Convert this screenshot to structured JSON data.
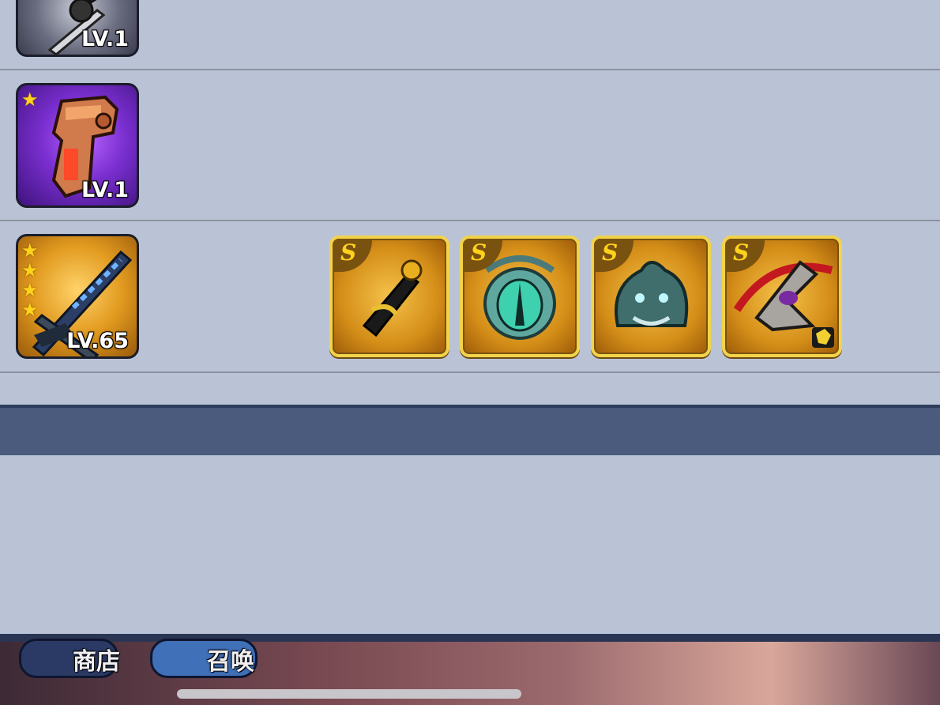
{
  "weapons": [
    {
      "level": "LV.1",
      "stars": 0,
      "icon": "katana-icon"
    },
    {
      "level": "LV.1",
      "stars": 1,
      "icon": "pipe-wrench-icon"
    },
    {
      "level": "LV.65",
      "stars": 4,
      "icon": "crossed-swords-icon"
    }
  ],
  "skills": [
    {
      "grade": "S",
      "icon": "scroll-icon"
    },
    {
      "grade": "S",
      "icon": "dragon-eye-icon"
    },
    {
      "grade": "S",
      "icon": "dragon-head-icon"
    },
    {
      "grade": "S",
      "icon": "claw-strike-icon"
    }
  ],
  "bottom_nav": {
    "shop_label": "商店",
    "summon_label": "召唤"
  },
  "colors": {
    "panel_bg": "#bac3d6",
    "section_bar": "#4a5b7e",
    "star": "#ffd21c",
    "skill_frame": "#f2d34a"
  }
}
